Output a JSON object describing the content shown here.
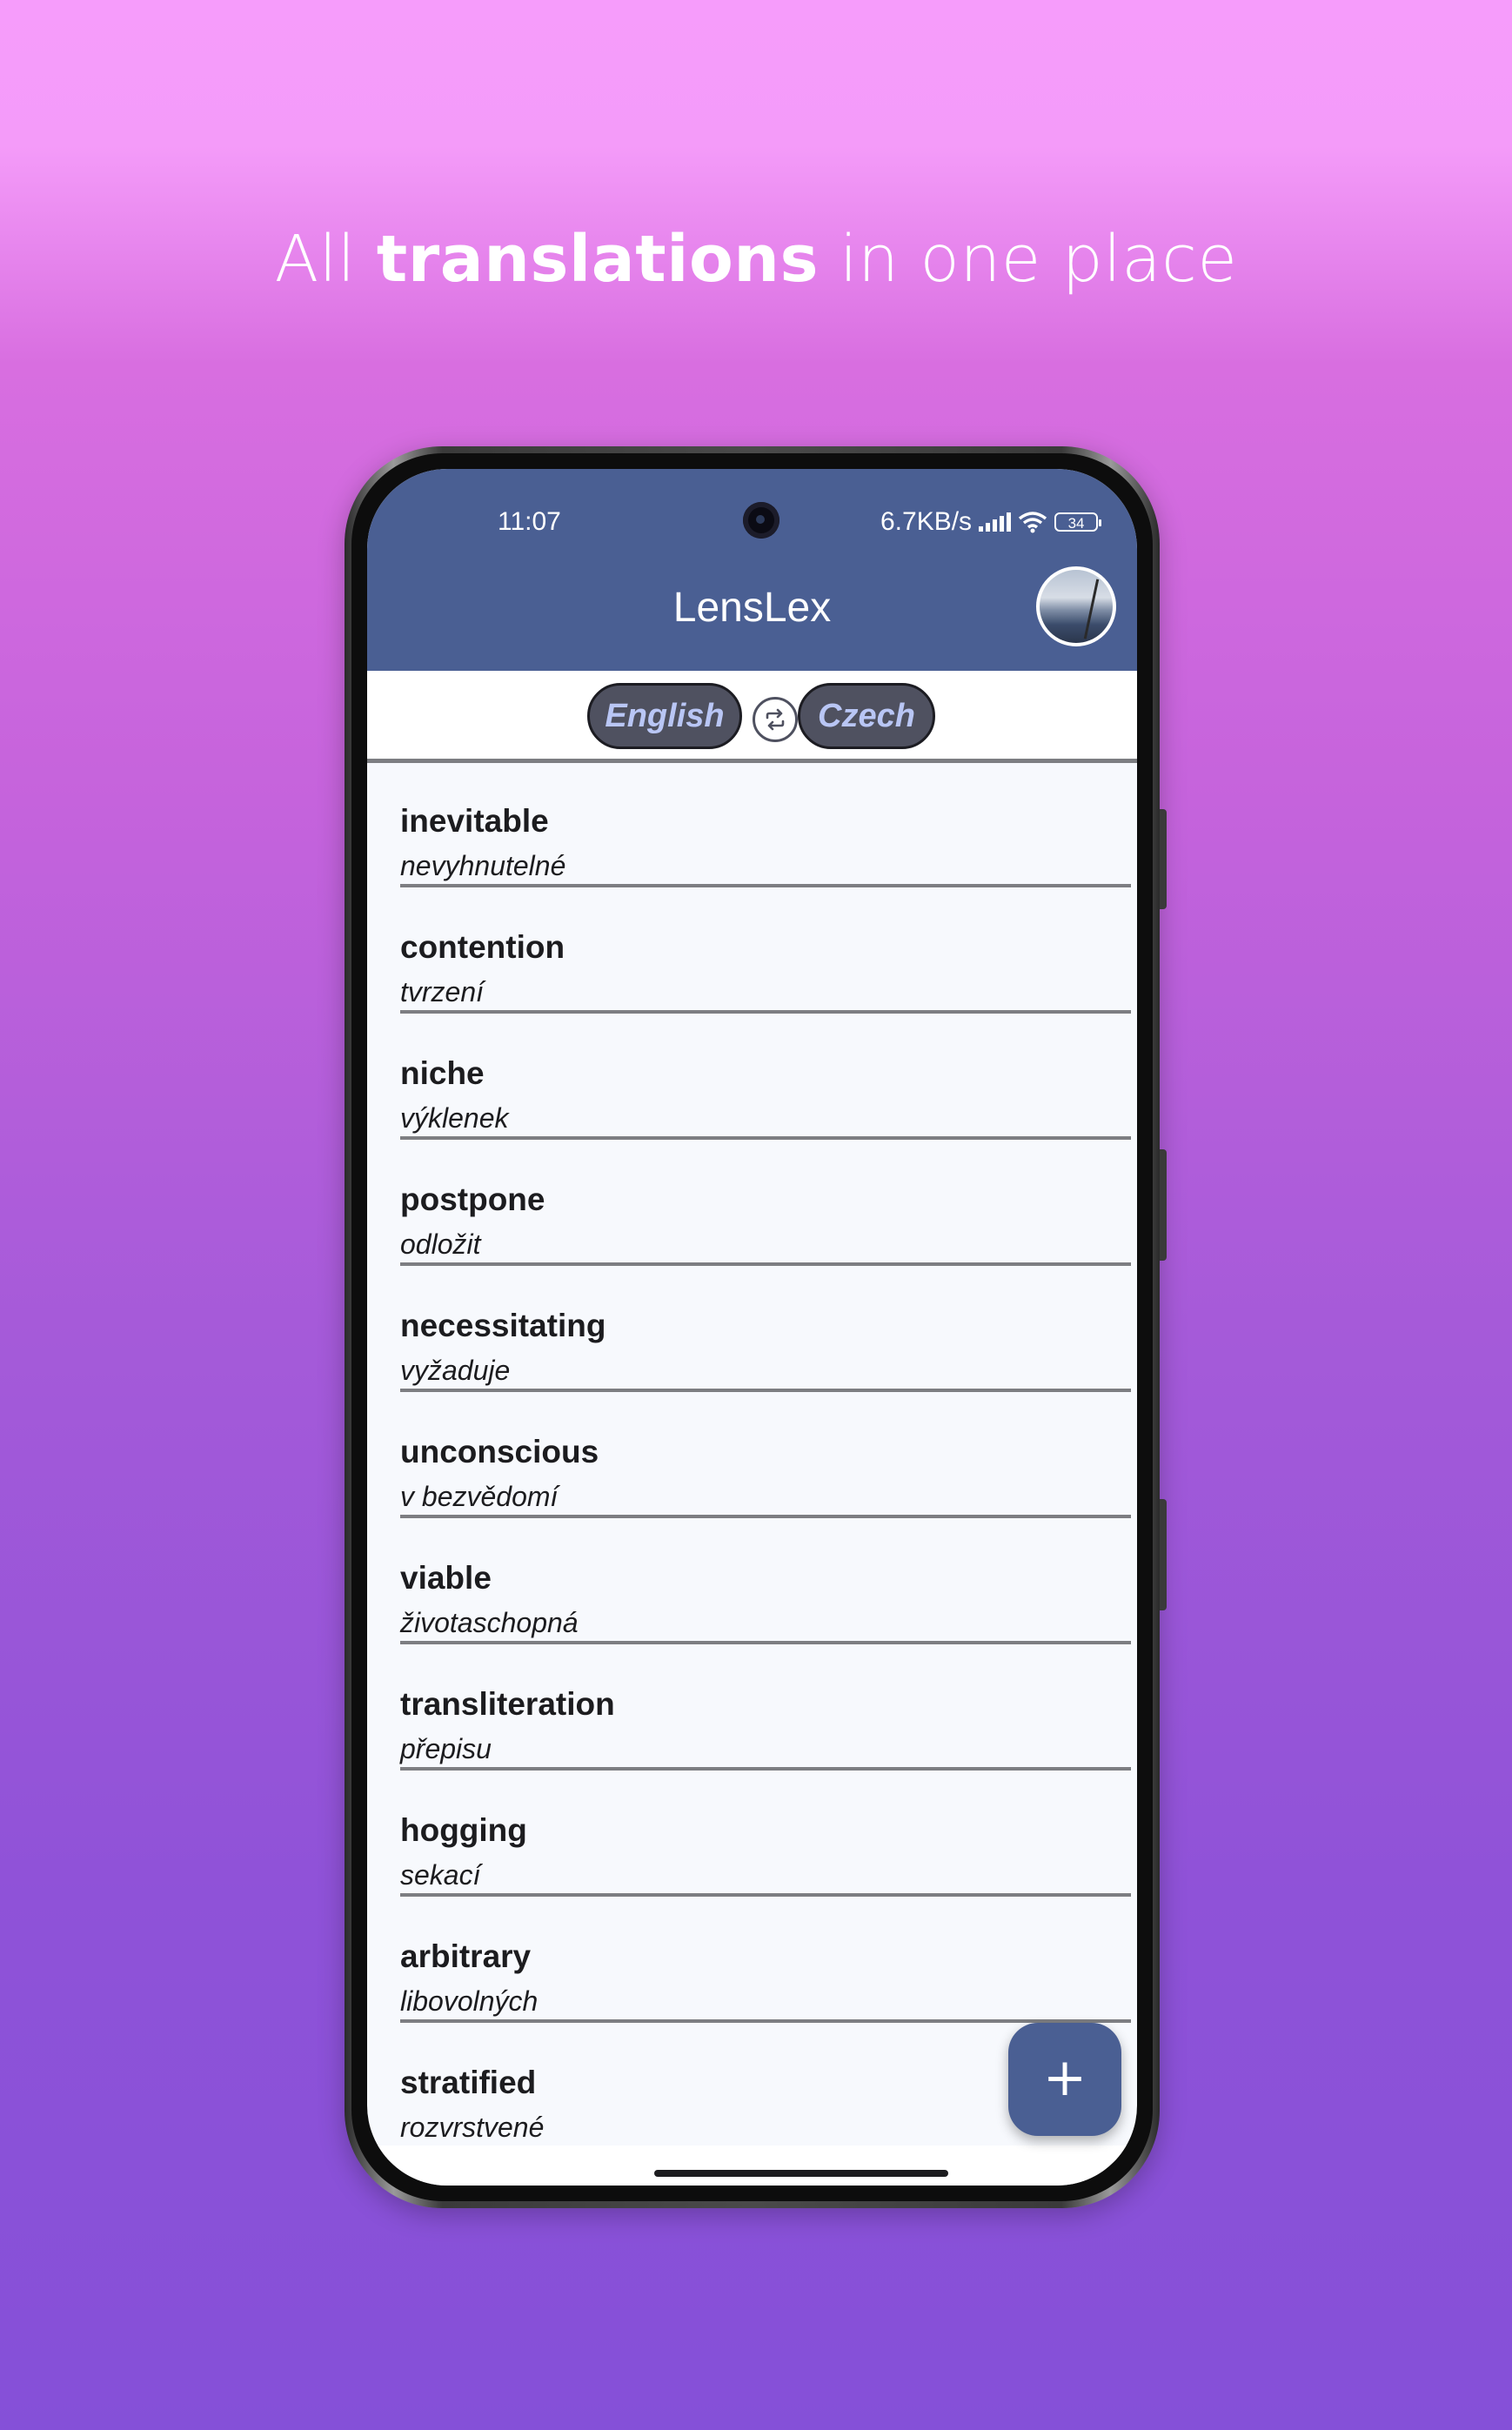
{
  "headline": {
    "prefix": "All",
    "bold": "translations",
    "suffix": "in one place"
  },
  "status_bar": {
    "time": "11:07",
    "network_speed": "6.7KB/s",
    "battery_level": "34",
    "icons": [
      "signal-icon",
      "wifi-icon",
      "battery-icon"
    ]
  },
  "app_bar": {
    "title": "LensLex",
    "avatar_icon": "profile-avatar",
    "color": "#4a5f93"
  },
  "language_bar": {
    "source_language": "English",
    "target_language": "Czech",
    "swap_icon": "swap-icon"
  },
  "entries": [
    {
      "word": "inevitable",
      "translation": "nevyhnutelné"
    },
    {
      "word": "contention",
      "translation": "tvrzení"
    },
    {
      "word": "niche",
      "translation": "výklenek"
    },
    {
      "word": "postpone",
      "translation": "odložit"
    },
    {
      "word": "necessitating",
      "translation": "vyžaduje"
    },
    {
      "word": "unconscious",
      "translation": "v bezvědomí"
    },
    {
      "word": "viable",
      "translation": "životaschopná"
    },
    {
      "word": "transliteration",
      "translation": "přepisu"
    },
    {
      "word": "hogging",
      "translation": "sekací"
    },
    {
      "word": "arbitrary",
      "translation": "libovolných"
    },
    {
      "word": "stratified",
      "translation": "rozvrstvené"
    }
  ],
  "fab": {
    "label": "+",
    "icon": "plus-icon"
  }
}
